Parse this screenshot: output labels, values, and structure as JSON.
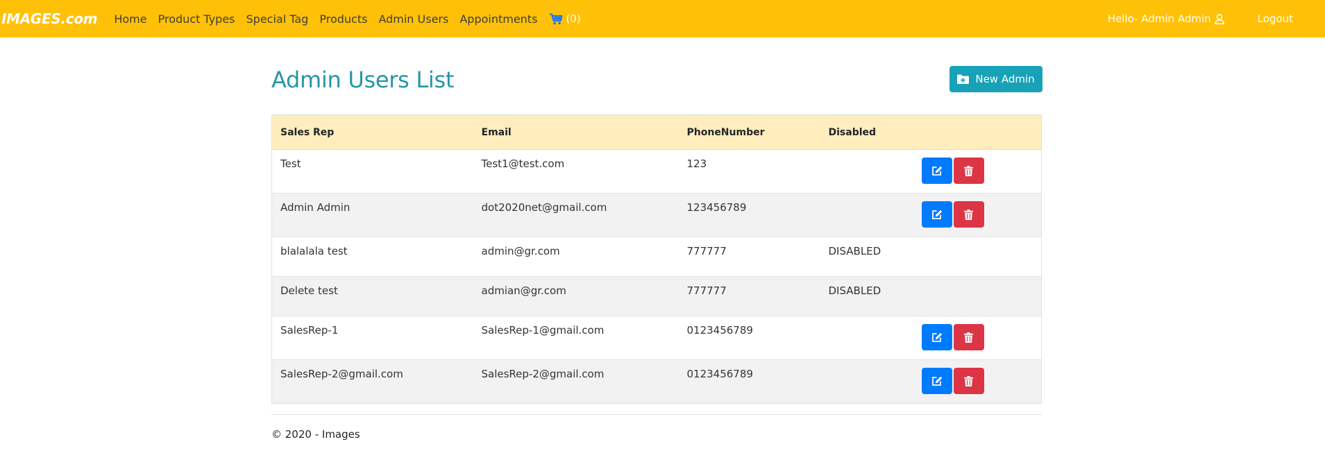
{
  "nav": {
    "brand": "IMAGES.com",
    "links": [
      "Home",
      "Product Types",
      "Special Tag",
      "Products",
      "Admin Users",
      "Appointments"
    ],
    "cart_count": "(0)",
    "greeting": "Hello- Admin Admin",
    "logout": "Logout"
  },
  "page": {
    "title": "Admin Users List",
    "new_button": "New Admin"
  },
  "table": {
    "headers": [
      "Sales Rep",
      "Email",
      "PhoneNumber",
      "Disabled"
    ],
    "rows": [
      {
        "rep": "Test",
        "email": "Test1@test.com",
        "phone": "123",
        "disabled": ""
      },
      {
        "rep": "Admin Admin",
        "email": "dot2020net@gmail.com",
        "phone": "123456789",
        "disabled": ""
      },
      {
        "rep": "blalalala test",
        "email": "admin@gr.com",
        "phone": "777777",
        "disabled": "DISABLED"
      },
      {
        "rep": "Delete test",
        "email": "admian@gr.com",
        "phone": "777777",
        "disabled": "DISABLED"
      },
      {
        "rep": "SalesRep-1",
        "email": "SalesRep-1@gmail.com",
        "phone": "0123456789",
        "disabled": ""
      },
      {
        "rep": "SalesRep-2@gmail.com",
        "email": "SalesRep-2@gmail.com",
        "phone": "0123456789",
        "disabled": ""
      }
    ]
  },
  "footer": "© 2020 - Images",
  "colors": {
    "navbar": "#ffc107",
    "title": "#2596a9",
    "new_button": "#17a2b8",
    "edit_button": "#007bff",
    "delete_button": "#dc3545",
    "header_row": "#ffedbd"
  },
  "icons": {
    "cart": "cart-icon",
    "user": "user-icon",
    "new_admin": "folder-plus-icon",
    "edit": "edit-icon",
    "delete": "trash-icon"
  }
}
